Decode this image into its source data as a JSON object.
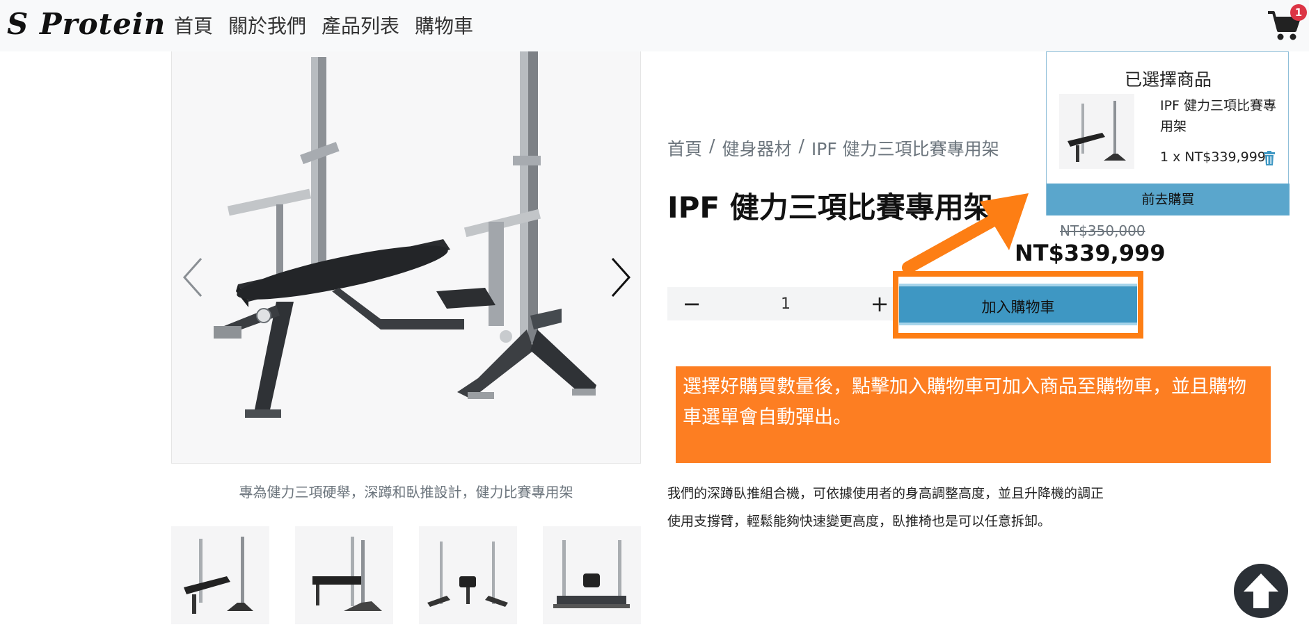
{
  "nav": {
    "brand": "S Protein",
    "links": [
      "首頁",
      "關於我們",
      "產品列表",
      "購物車"
    ],
    "cart_count": "1"
  },
  "product": {
    "breadcrumb": [
      "首頁",
      "健身器材",
      "IPF 健力三項比賽專用架"
    ],
    "title": "IPF 健力三項比賽專用架",
    "price_old": "NT$350,000",
    "price_new": "NT$339,999",
    "quantity": "1",
    "add_to_cart_label": "加入購物車",
    "caption": "專為健力三項硬舉，深蹲和臥推設計，健力比賽專用架",
    "description_lines": [
      "我們的深蹲臥推組合機，可依據使用者的身高調整高度，並且升降機的調正",
      "使用支撐臂，輕鬆能夠快速變更高度，臥推椅也是可以任意拆卸。"
    ]
  },
  "notice": {
    "text": "選擇好購買數量後，點擊加入購物車可加入商品至購物車，並且購物車選單會自動彈出。"
  },
  "cart_popup": {
    "title": "已選擇商品",
    "item_name": "IPF 健力三項比賽專用架",
    "item_price": "1 x NT$339,999",
    "checkout_label": "前去購買"
  },
  "colors": {
    "accent_blue": "#3e97c3",
    "highlight_orange": "#fd7e14",
    "badge_red": "#dc3545"
  }
}
